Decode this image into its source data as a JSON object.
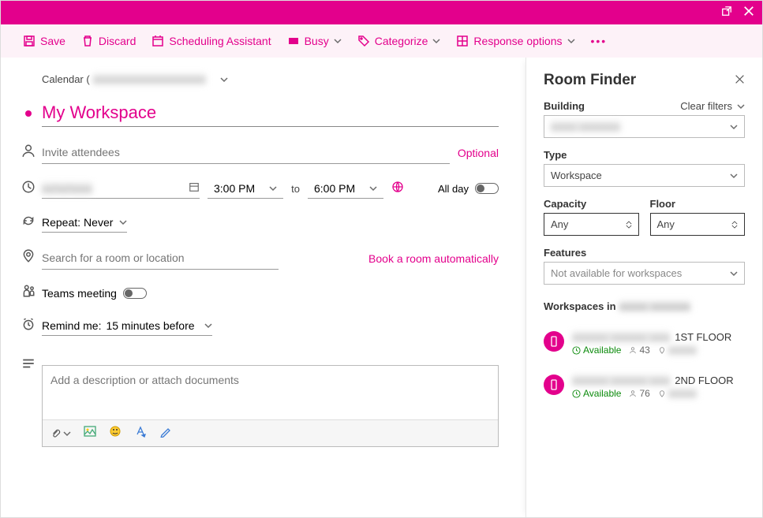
{
  "toolbar": {
    "save": "Save",
    "discard": "Discard",
    "scheduling": "Scheduling Assistant",
    "busy": "Busy",
    "categorize": "Categorize",
    "response": "Response options"
  },
  "calendar_label": "Calendar (",
  "event": {
    "title": "My Workspace",
    "invite_placeholder": "Invite attendees",
    "optional": "Optional",
    "start_time": "3:00 PM",
    "to": "to",
    "end_time": "6:00 PM",
    "all_day": "All day",
    "repeat_label": "Repeat:",
    "repeat_value": "Never",
    "location_placeholder": "Search for a room or location",
    "book_auto": "Book a room automatically",
    "teams_meeting": "Teams meeting",
    "remind_label": "Remind me:",
    "remind_value": "15 minutes before",
    "desc_placeholder": "Add a description or attach documents"
  },
  "room_finder": {
    "title": "Room Finder",
    "building_label": "Building",
    "clear_filters": "Clear filters",
    "type_label": "Type",
    "type_value": "Workspace",
    "capacity_label": "Capacity",
    "capacity_value": "Any",
    "floor_label": "Floor",
    "floor_value": "Any",
    "features_label": "Features",
    "features_value": "Not available for workspaces",
    "workspaces_in": "Workspaces in",
    "results": [
      {
        "floor": "1ST FLOOR",
        "status": "Available",
        "capacity": "43"
      },
      {
        "floor": "2ND FLOOR",
        "status": "Available",
        "capacity": "76"
      }
    ]
  }
}
